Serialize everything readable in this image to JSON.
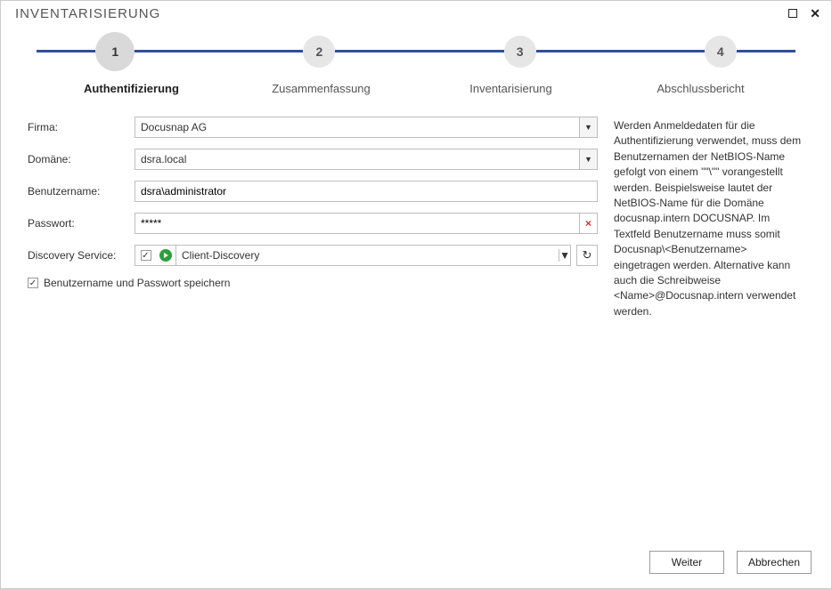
{
  "window": {
    "title": "INVENTARISIERUNG"
  },
  "steps": [
    {
      "num": "1",
      "label": "Authentifizierung"
    },
    {
      "num": "2",
      "label": "Zusammenfassung"
    },
    {
      "num": "3",
      "label": "Inventarisierung"
    },
    {
      "num": "4",
      "label": "Abschlussbericht"
    }
  ],
  "form": {
    "labels": {
      "firma": "Firma:",
      "domaene": "Domäne:",
      "benutzer": "Benutzername:",
      "passwort": "Passwort:",
      "discovery": "Discovery Service:"
    },
    "values": {
      "firma": "Docusnap AG",
      "domaene": "dsra.local",
      "benutzer": "dsra\\administrator",
      "passwort": "*****",
      "discovery": "Client-Discovery"
    },
    "remember_label": "Benutzername und Passwort speichern"
  },
  "help_text": "Werden Anmeldedaten für die Authentifizierung verwendet, muss dem Benutzernamen der NetBIOS-Name gefolgt von einem \"\"\\\"\" vorangestellt werden. Beispielsweise lautet der NetBIOS-Name für die Domäne docusnap.intern DOCUSNAP. Im Textfeld Benutzername muss somit Docusnap\\<Benutzername> eingetragen werden. Alternative kann auch die Schreibweise <Name>@Docusnap.intern verwendet werden.",
  "buttons": {
    "next": "Weiter",
    "cancel": "Abbrechen"
  }
}
